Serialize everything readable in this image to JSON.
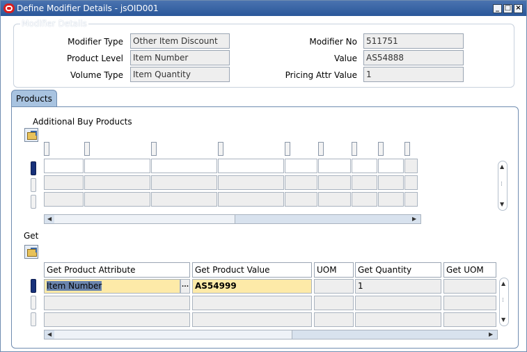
{
  "window": {
    "title": "Define Modifier Details - jsOID001"
  },
  "header_group": {
    "legend": "Modifier Details",
    "modifier_type_label": "Modifier Type",
    "modifier_type_value": "Other Item Discount",
    "product_level_label": "Product  Level",
    "product_level_value": "Item Number",
    "volume_type_label": "Volume Type",
    "volume_type_value": "Item Quantity",
    "modifier_no_label": "Modifier No",
    "modifier_no_value": "511751",
    "value_label": "Value",
    "value_value": "AS54888",
    "pricing_attr_label": "Pricing Attr Value",
    "pricing_attr_value": "1"
  },
  "tabs": {
    "products_label": "Products"
  },
  "additional_buy": {
    "label": "Additional Buy Products"
  },
  "get": {
    "label": "Get",
    "columns": {
      "attribute": "Get Product Attribute",
      "value": "Get Product Value",
      "uom": "UOM",
      "quantity": "Get Quantity",
      "get_uom": "Get UOM"
    },
    "row1": {
      "attribute": "Item Number",
      "value": "AS54999",
      "quantity": "1"
    },
    "lov_glyph": "..."
  },
  "icons": {
    "minimize": "minimize-icon",
    "maximize": "maximize-icon",
    "close": "close-icon",
    "folder": "open-folder-icon",
    "scroll_up": "arrow-up-icon",
    "scroll_down": "arrow-down-icon",
    "scroll_left": "arrow-left-icon",
    "scroll_right": "arrow-right-icon"
  },
  "colors": {
    "titlebar": "#2a579a",
    "tab": "#a8c3e0",
    "highlight": "#fdeaa8",
    "row_indicator_active": "#17317a"
  }
}
